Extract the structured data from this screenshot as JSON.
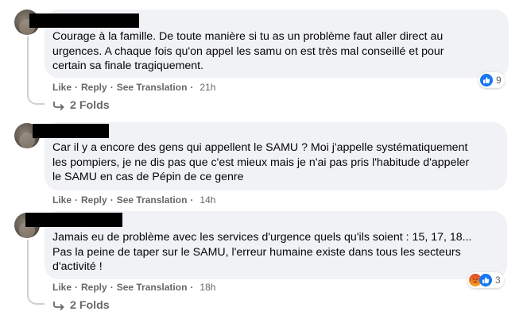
{
  "comments": [
    {
      "text": "Courage à la famille. De toute manière si tu as un problème faut aller direct au\nurgences. A chaque fois qu'on appel les samu on est très mal conseillé et pour\ncertain sa finale tragiquement.",
      "like": "Like",
      "reply": "Reply",
      "see_translation": "See Translation",
      "time": "21h",
      "reaction_count": "9",
      "folds": "2 Folds"
    },
    {
      "text": "Car il y a encore des gens qui appellent le SAMU ? Moi j'appelle systématiquement\nles pompiers, je ne dis pas que c'est mieux mais je n'ai pas pris l'habitude d'appeler\nle SAMU en cas de Pépin de ce genre",
      "like": "Like",
      "reply": "Reply",
      "see_translation": "See Translation",
      "time": "14h"
    },
    {
      "text": "Jamais eu de problème avec les services d'urgence quels qu'ils soient : 15, 17, 18...\nPas la peine de taper sur le SAMU, l'erreur humaine existe dans tous les secteurs\nd'activité !",
      "like": "Like",
      "reply": "Reply",
      "see_translation": "See Translation",
      "time": "18h",
      "reaction_count": "3",
      "folds": "2 Folds"
    }
  ],
  "colors": {
    "bubble": "#f0f2f5",
    "meta": "#65676b",
    "like_blue": "#1877f2"
  }
}
